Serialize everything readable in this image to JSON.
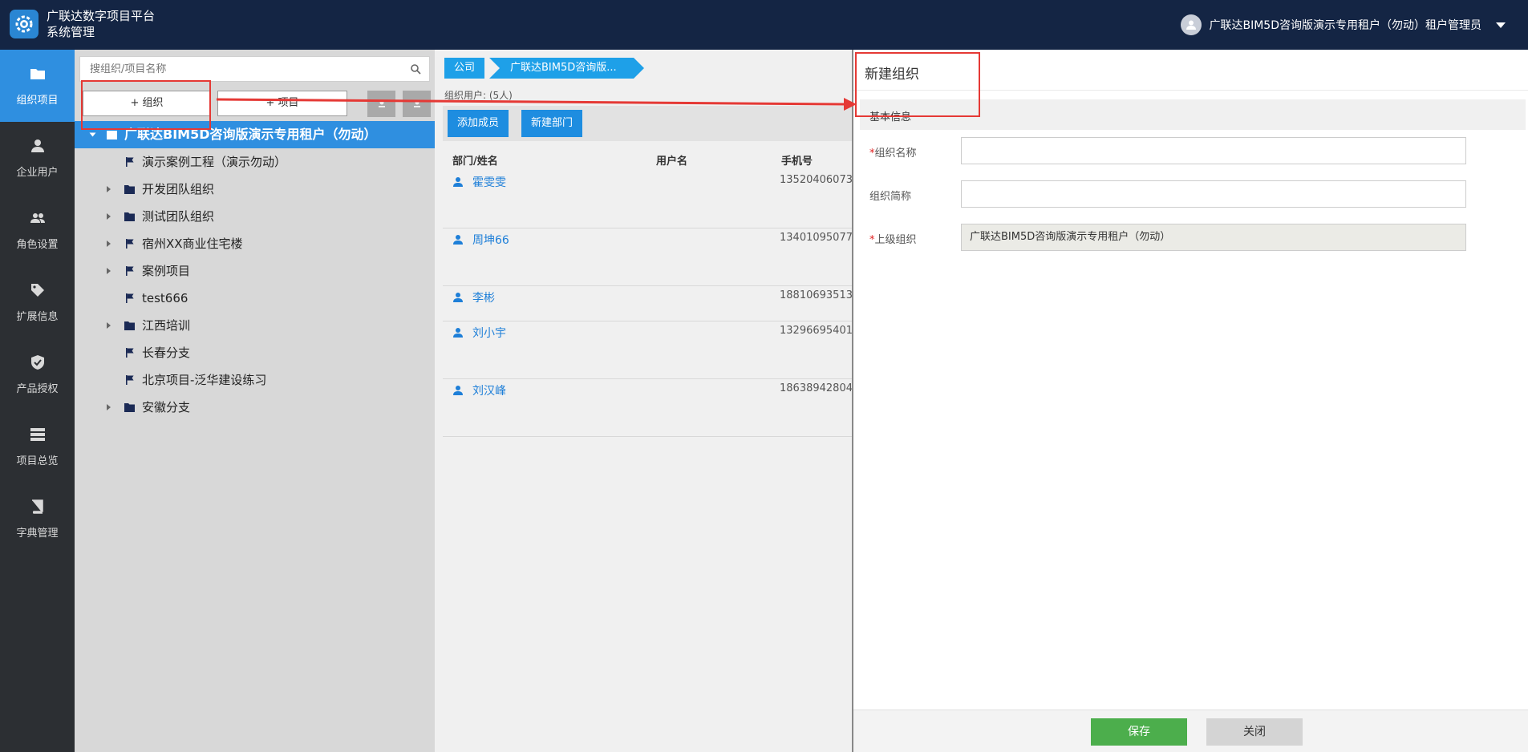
{
  "header": {
    "app_title": "广联达数字项目平台",
    "app_subtitle": "系统管理",
    "user_label": "广联达BIM5D咨询版演示专用租户（勿动）租户管理员"
  },
  "nav": {
    "items": [
      {
        "label": "组织项目",
        "icon": "folder-icon",
        "active": true
      },
      {
        "label": "企业用户",
        "icon": "user-icon"
      },
      {
        "label": "角色设置",
        "icon": "users-icon"
      },
      {
        "label": "扩展信息",
        "icon": "tag-icon"
      },
      {
        "label": "产品授权",
        "icon": "shield-check-icon"
      },
      {
        "label": "项目总览",
        "icon": "list-icon"
      },
      {
        "label": "字典管理",
        "icon": "book-icon"
      }
    ]
  },
  "tree": {
    "search_placeholder": "搜组织/项目名称",
    "add_org_label": "+ 组织",
    "add_project_label": "+ 项目",
    "root_label": "广联达BIM5D咨询版演示专用租户（勿动）",
    "items": [
      {
        "label": "演示案例工程（演示勿动）",
        "type": "project",
        "expandable": false
      },
      {
        "label": "开发团队组织",
        "type": "org",
        "expandable": true
      },
      {
        "label": "测试团队组织",
        "type": "org",
        "expandable": true
      },
      {
        "label": "宿州XX商业住宅楼",
        "type": "project",
        "expandable": true
      },
      {
        "label": "案例项目",
        "type": "project",
        "expandable": true
      },
      {
        "label": "test666",
        "type": "project",
        "expandable": false
      },
      {
        "label": "江西培训",
        "type": "org",
        "expandable": true
      },
      {
        "label": "长春分支",
        "type": "project",
        "expandable": false
      },
      {
        "label": "北京项目-泛华建设练习",
        "type": "project",
        "expandable": false
      },
      {
        "label": "安徽分支",
        "type": "org",
        "expandable": true
      }
    ]
  },
  "middle": {
    "breadcrumb": [
      "公司",
      "广联达BIM5D咨询版..."
    ],
    "org_users_label": "组织用户: (5人)",
    "add_member_label": "添加成员",
    "new_dept_label": "新建部门",
    "columns": [
      "部门/姓名",
      "用户名",
      "手机号"
    ],
    "rows": [
      {
        "name": "霍雯雯",
        "phone": "13520406073"
      },
      {
        "name": "周坤66",
        "phone": "13401095077"
      },
      {
        "name": "李彬",
        "phone": "18810693513"
      },
      {
        "name": "刘小宇",
        "phone": "13296695401"
      },
      {
        "name": "刘汉峰",
        "phone": "18638942804"
      }
    ]
  },
  "dialog": {
    "title": "新建组织",
    "section_label": "基本信息",
    "org_name_label": "组织名称",
    "org_short_label": "组织简称",
    "parent_org_label": "上级组织",
    "parent_org_value": "广联达BIM5D咨询版演示专用租户（勿动）",
    "required_mark": "*",
    "save_label": "保存",
    "close_label": "关闭"
  },
  "colors": {
    "header_bg": "#142544",
    "nav_bg": "#2c2f33",
    "accent_blue": "#2f8fe0",
    "save_green": "#4cae4c",
    "annotation_red": "#e53935"
  }
}
